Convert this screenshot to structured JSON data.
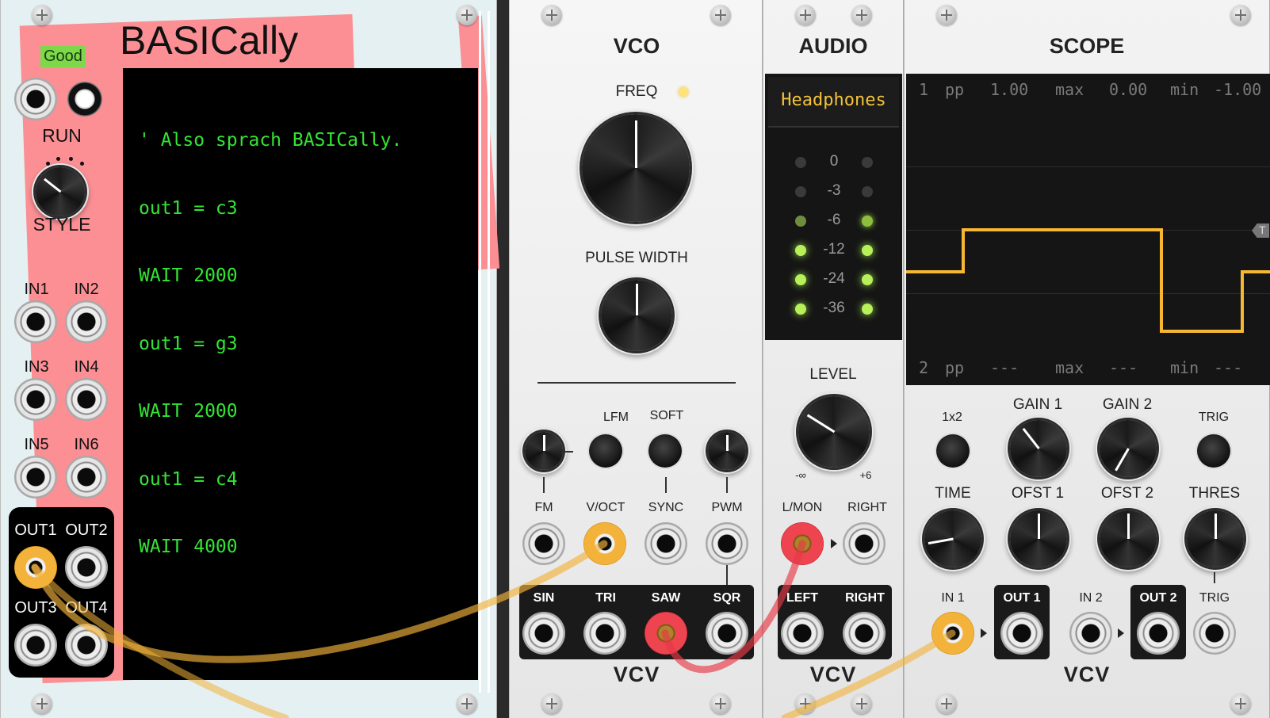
{
  "basically": {
    "title": "BASICally",
    "status": "Good",
    "run_label": "RUN",
    "style_label": "STYLE",
    "code_lines": [
      "' Also sprach BASICally.",
      "out1 = c3",
      "WAIT 2000",
      "out1 = g3",
      "WAIT 2000",
      "out1 = c4",
      "WAIT 4000"
    ],
    "inputs": [
      "IN1",
      "IN2",
      "IN3",
      "IN4",
      "IN5",
      "IN6"
    ],
    "outputs": [
      "OUT1",
      "OUT2",
      "OUT3",
      "OUT4"
    ]
  },
  "vco": {
    "title": "VCO",
    "freq_label": "FREQ",
    "pw_label": "PULSE WIDTH",
    "lfm_label": "LFM",
    "soft_label": "SOFT",
    "input_labels": [
      "FM",
      "V/OCT",
      "SYNC",
      "PWM"
    ],
    "output_labels": [
      "SIN",
      "TRI",
      "SAW",
      "SQR"
    ],
    "brand": "VCV"
  },
  "audio": {
    "title": "AUDIO",
    "device": "Headphones",
    "meter_levels": [
      "0",
      "-3",
      "-6",
      "-12",
      "-24",
      "-36"
    ],
    "level_label": "LEVEL",
    "level_min": "-∞",
    "level_max": "+6",
    "input_labels": [
      "L/MON",
      "RIGHT"
    ],
    "output_labels": [
      "LEFT",
      "RIGHT"
    ],
    "brand": "VCV"
  },
  "scope": {
    "title": "SCOPE",
    "ch1": {
      "num": "1",
      "pp_label": "pp",
      "pp": "1.00",
      "max_label": "max",
      "max": "0.00",
      "min_label": "min",
      "min": "-1.00"
    },
    "ch2": {
      "num": "2",
      "pp_label": "pp",
      "pp": "---",
      "max_label": "max",
      "max": "---",
      "min_label": "min",
      "min": "---"
    },
    "trigger_marker": "T",
    "knob_labels_row1": [
      "GAIN 1",
      "GAIN 2"
    ],
    "mode_label": "1x2",
    "trig_button_label": "TRIG",
    "knob_labels_row2": [
      "TIME",
      "OFST 1",
      "OFST 2",
      "THRES"
    ],
    "jack_labels": [
      "IN 1",
      "OUT 1",
      "IN 2",
      "OUT 2",
      "TRIG"
    ],
    "brand": "VCV",
    "trace_color": "#f7b733"
  },
  "colors": {
    "code_text": "#33e533",
    "status_bg": "#7dd94a",
    "cable_orange": "#f3b23a",
    "cable_red": "#e63946"
  }
}
